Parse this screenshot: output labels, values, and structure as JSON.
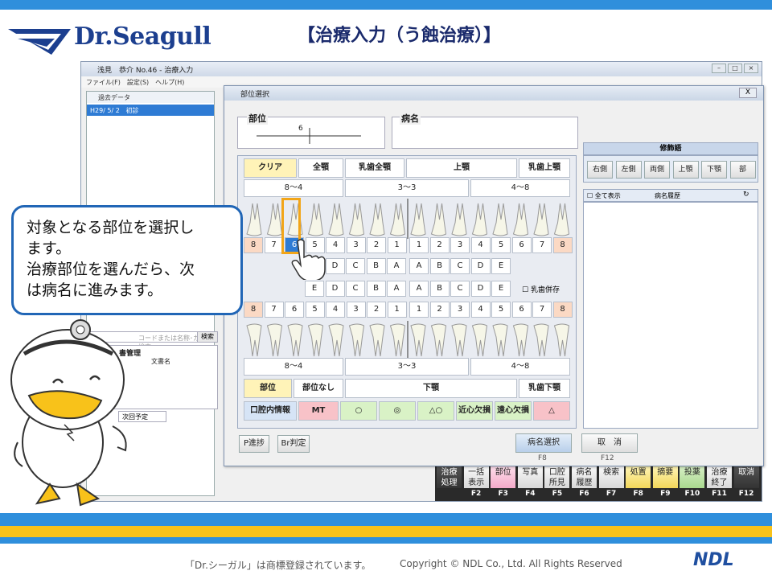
{
  "slide": {
    "title": "【治療入力（う蝕治療）】",
    "logo_text": "Dr.Seagull",
    "footer_trademark": "「Dr.シーガル」は商標登録されています。",
    "footer_copyright": "Copyright © NDL Co., Ltd. All Rights Reserved",
    "footer_logo": "NDL"
  },
  "window": {
    "title": "浅見　恭介 No.46 - 治療入力",
    "menu": "ファイル(F)　設定(S)　ヘルプ(H)",
    "past_data_label": "過去データ",
    "past_row_date": "H29/ 5/ 2",
    "past_row_type": "初診",
    "search_placeholder": "コードまたは名称･カナで検索",
    "search_button": "検索",
    "doc_mgmt_label": "書管理",
    "doc_name_col": "文書名",
    "next_plan_tab": "次回予定",
    "left_tab_fragment": "E"
  },
  "toolbar": {
    "items": [
      {
        "label": "治療\n処理",
        "fkey": ""
      },
      {
        "label": "一括\n表示",
        "fkey": "F2"
      },
      {
        "label": "部位",
        "fkey": "F3"
      },
      {
        "label": "写真",
        "fkey": "F4"
      },
      {
        "label": "口腔\n所見",
        "fkey": "F5"
      },
      {
        "label": "病名\n履歴",
        "fkey": "F6"
      },
      {
        "label": "検索",
        "fkey": "F7"
      },
      {
        "label": "処置",
        "fkey": "F8"
      },
      {
        "label": "摘要",
        "fkey": "F9"
      },
      {
        "label": "投薬",
        "fkey": "F10"
      },
      {
        "label": "治療\n終了",
        "fkey": "F11"
      },
      {
        "label": "取消",
        "fkey": "F12"
      }
    ]
  },
  "dialog": {
    "title": "部位選択",
    "close": "X",
    "bui_label": "部位",
    "bui_value": "6",
    "byomei_label": "病名",
    "buttons_top": [
      "クリア",
      "全顎",
      "乳歯全顎",
      "上顎",
      "乳歯上顎"
    ],
    "range_top": [
      "8～4",
      "3～3",
      "4～8"
    ],
    "upper_left_nums": [
      "8",
      "7",
      "6",
      "5",
      "4",
      "3",
      "2",
      "1"
    ],
    "upper_right_nums": [
      "1",
      "2",
      "3",
      "4",
      "5",
      "6",
      "7",
      "8"
    ],
    "upper_left_letters": [
      "E",
      "D",
      "C",
      "B",
      "A"
    ],
    "upper_right_letters": [
      "A",
      "B",
      "C",
      "D",
      "E"
    ],
    "lower_left_letters": [
      "E",
      "D",
      "C",
      "B",
      "A"
    ],
    "lower_right_letters": [
      "A",
      "B",
      "C",
      "D",
      "E"
    ],
    "lower_left_nums": [
      "8",
      "7",
      "6",
      "5",
      "4",
      "3",
      "2",
      "1"
    ],
    "lower_right_nums": [
      "1",
      "2",
      "3",
      "4",
      "5",
      "6",
      "7",
      "8"
    ],
    "nyushi_heizon": "乳歯併存",
    "range_bottom": [
      "8～4",
      "3～3",
      "4～8"
    ],
    "buttons_bottom": [
      "部位",
      "部位なし",
      "下顎",
      "乳歯下顎"
    ],
    "row_last": [
      "口腔内情報",
      "MT",
      "○",
      "◎",
      "△○",
      "近心欠損",
      "遠心欠損",
      "△"
    ],
    "shushoku_header": "修飾語",
    "shushoku_buttons": [
      "右側",
      "左側",
      "両側",
      "上顎",
      "下顎",
      "部"
    ],
    "show_all": "全て表示",
    "history_header": "病名履歴",
    "p_button": "P進捗",
    "br_button": "Br判定",
    "byomei_select": "病名選択",
    "byomei_select_key": "F8",
    "cancel": "取　消",
    "cancel_key": "F12"
  },
  "callout": {
    "line1": "対象となる部位を選択し",
    "line2": "ます。",
    "line3": "治療部位を選んだら、次",
    "line4": "は病名に進みます。"
  },
  "colors": {
    "brand_blue": "#2f8fdc",
    "brand_yellow": "#f8c21a",
    "callout_border": "#2166b6",
    "selected_tooth": "#2e7bd4",
    "highlight": "#f2a518"
  }
}
